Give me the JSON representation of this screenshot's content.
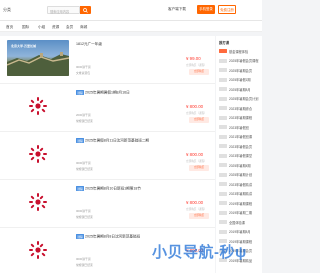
{
  "header": {
    "logo_text": "分类",
    "search_placeholder": "搜索应用内容",
    "app_download": "客户端下载",
    "login_label": "手机登录",
    "register_label": "免费注册"
  },
  "nav": {
    "items": [
      "首页",
      "国际",
      "小组",
      "资源",
      "会员",
      "商城"
    ]
  },
  "courses": [
    {
      "thumb": "sky",
      "banner": "北京大学·万里长城",
      "badge": "",
      "title": "1812元广一年级",
      "meta1": "0000讲干货",
      "meta2": "文章资源包",
      "price": "¥ 99.00",
      "sub": "立即购买（课程）",
      "btn": "立即购买"
    },
    {
      "thumb": "plain",
      "badge": "课程",
      "title": "2025年暑期暑假1期8月16日",
      "meta1": "2000讲干货",
      "meta2": "常规课已结束",
      "price": "¥ 800.00",
      "sub": "立即购买（课程）",
      "btn": "立即购买"
    },
    {
      "thumb": "plain",
      "badge": "课程",
      "title": "2025年暑假8月11日沈河新范基础班二期",
      "meta1": "0000讲干货",
      "meta2": "常规课已结束",
      "price": "¥ 800.00",
      "sub": "立即购买（课程）",
      "btn": "立即购买"
    },
    {
      "thumb": "plain",
      "badge": "课程",
      "title": "2025年暑期8月10日新班1期第18节",
      "meta1": "0000讲干货",
      "meta2": "常规课已结束",
      "price": "¥ 800.00",
      "sub": "立即购买（课程）",
      "btn": "立即购买"
    },
    {
      "thumb": "plain",
      "badge": "课程",
      "title": "2025年暑期8月8日沈河新范基础班",
      "meta1": "0000讲干货",
      "meta2": "常规课已结束",
      "price": "¥ 800.00",
      "sub": "",
      "btn": ""
    }
  ],
  "sidebar": {
    "title": "报打课",
    "items": [
      {
        "tag_color": "#ff6a3d",
        "label": "基金课程体验"
      },
      {
        "tag_color": "#e0e0e0",
        "label": "2025年暑假会员课程"
      },
      {
        "tag_color": "#e0e0e0",
        "label": "2025年暑期会员"
      },
      {
        "tag_color": "#e0e0e0",
        "label": "2025年暑假1期"
      },
      {
        "tag_color": "#e0e0e0",
        "label": "2025年暑期8月"
      },
      {
        "tag_color": "#e0e0e0",
        "label": "2025年暑期会员计划"
      },
      {
        "tag_color": "#e0e0e0",
        "label": "2023年暑期综合"
      },
      {
        "tag_color": "#e0e0e0",
        "label": "2023年暑期课程"
      },
      {
        "tag_color": "#e0e0e0",
        "label": "2023年暑假班"
      },
      {
        "tag_color": "#e0e0e0",
        "label": "2021年暑假班课"
      },
      {
        "tag_color": "#e0e0e0",
        "label": "2023年暑假会员"
      },
      {
        "tag_color": "#e0e0e0",
        "label": "2023年暑假课堂"
      },
      {
        "tag_color": "#e0e0e0",
        "label": "2025年暑期4期"
      },
      {
        "tag_color": "#e0e0e0",
        "label": "2025年暑期计划"
      },
      {
        "tag_color": "#e0e0e0",
        "label": "2023年暑假精讲"
      },
      {
        "tag_color": "#e0e0e0",
        "label": "2023年暑期精讲"
      },
      {
        "tag_color": "#e0e0e0",
        "label": "2019年暑期课程"
      },
      {
        "tag_color": "#e0e0e0",
        "label": "2019年暑期二期"
      },
      {
        "tag_color": "#e0e0e0",
        "label": "全国体验课"
      },
      {
        "tag_color": "#e0e0e0",
        "label": "2019年暑期8月"
      },
      {
        "tag_color": "#e0e0e0",
        "label": "2019年暑期课程"
      },
      {
        "tag_color": "#e0e0e0",
        "label": "2019年暑期会员"
      },
      {
        "tag_color": "#e0e0e0",
        "label": "2019年暑期精品"
      }
    ]
  },
  "watermark": "小贝导航-秒ψ",
  "colors": {
    "accent": "#ff6600",
    "price": "#ff3b30",
    "badge": "#4a90e2",
    "logo_red": "#c8102e"
  }
}
